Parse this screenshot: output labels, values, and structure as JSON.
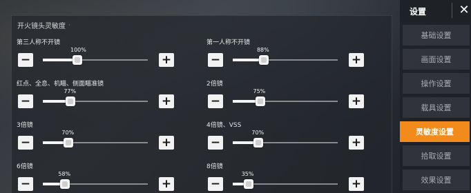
{
  "panel": {
    "title": "开火镜头灵敏度",
    "title_dot": "·"
  },
  "settings": [
    {
      "label": "第三人称不开镜",
      "percent_label": "100%",
      "value": 100
    },
    {
      "label": "第一人称不开镜",
      "percent_label": "88%",
      "value": 88
    },
    {
      "label": "红点、全息、机瞄、侧面瞄准镜",
      "percent_label": "77%",
      "value": 77
    },
    {
      "label": "2倍镜",
      "percent_label": "75%",
      "value": 75
    },
    {
      "label": "3倍镜",
      "percent_label": "70%",
      "value": 70
    },
    {
      "label": "4倍镜、VSS",
      "percent_label": "70%",
      "value": 70
    },
    {
      "label": "6倍镜",
      "percent_label": "58%",
      "value": 58
    },
    {
      "label": "8倍镜",
      "percent_label": "35%",
      "value": 35
    }
  ],
  "controls": {
    "minus": "−",
    "plus": "+"
  },
  "sidebar": {
    "title": "设置",
    "close": "✕",
    "items": [
      {
        "label": "基础设置",
        "active": false
      },
      {
        "label": "画面设置",
        "active": false
      },
      {
        "label": "操作设置",
        "active": false
      },
      {
        "label": "载具设置",
        "active": false
      },
      {
        "label": "灵敏度设置",
        "active": true
      },
      {
        "label": "拾取设置",
        "active": false
      },
      {
        "label": "效果设置",
        "active": false
      }
    ]
  },
  "colors": {
    "accent": "#f28a1c"
  }
}
